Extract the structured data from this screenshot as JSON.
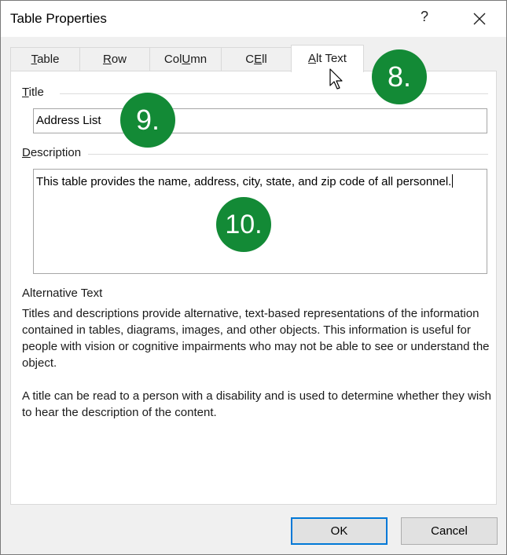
{
  "window": {
    "title": "Table Properties",
    "help_label": "?"
  },
  "tabs": [
    {
      "label": "Table",
      "accesskey": "T"
    },
    {
      "label": "Row",
      "accesskey": "R"
    },
    {
      "label": "Column",
      "accesskey": "U"
    },
    {
      "label": "Cell",
      "accesskey": "E"
    },
    {
      "label": "Alt Text",
      "accesskey": "A",
      "active": true
    }
  ],
  "title_field": {
    "label": "Title",
    "value": "Address List"
  },
  "description_field": {
    "label": "Description",
    "value": "This table provides the name, address, city, state, and zip code of all personnel."
  },
  "info": {
    "heading": "Alternative Text",
    "paragraph1": "Titles and descriptions provide alternative, text-based representations of the information contained in tables, diagrams, images, and other objects. This information is useful for people with vision or cognitive impairments who may not be able to see or understand the object.",
    "paragraph2": "A title can be read to a person with a disability and is used to determine whether they wish to hear the description of the content."
  },
  "buttons": {
    "ok": "OK",
    "cancel": "Cancel"
  },
  "badges": {
    "tab": "8.",
    "title": "9.",
    "description": "10."
  },
  "colors": {
    "badge": "#138a36",
    "default_button_border": "#0078d7"
  }
}
